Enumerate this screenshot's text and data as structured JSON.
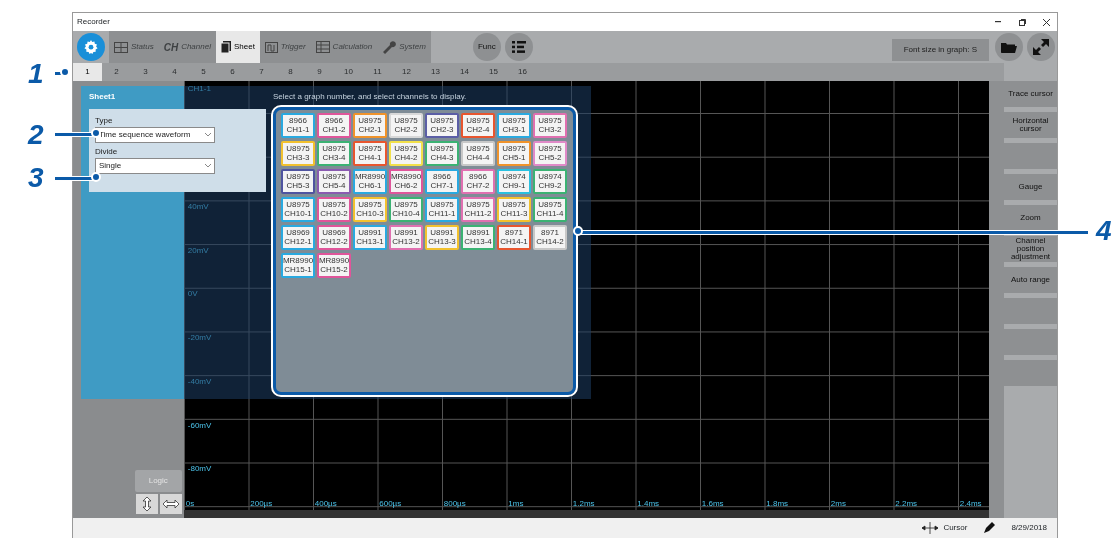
{
  "window": {
    "title": "Recorder"
  },
  "toolbar": {
    "tabs": [
      {
        "kind": "status",
        "label": "Status",
        "selected": false,
        "disabled": true
      },
      {
        "kind": "channel",
        "label": "Channel",
        "icon_text": "CH",
        "selected": false,
        "disabled": true
      },
      {
        "kind": "sheet",
        "label": "Sheet",
        "selected": true,
        "disabled": false
      },
      {
        "kind": "trigger",
        "label": "Trigger",
        "selected": false,
        "disabled": true
      },
      {
        "kind": "calculation",
        "label": "Calculation",
        "selected": false,
        "disabled": true
      },
      {
        "kind": "system",
        "label": "System",
        "selected": false,
        "disabled": true
      }
    ],
    "func_button": "Func",
    "font_size_button": "Font size in graph: S"
  },
  "sheet_tabs": [
    {
      "label": "1",
      "selected": true
    },
    {
      "label": "2",
      "selected": false
    },
    {
      "label": "3",
      "selected": false
    },
    {
      "label": "4",
      "selected": false
    },
    {
      "label": "5",
      "selected": false
    },
    {
      "label": "6",
      "selected": false
    },
    {
      "label": "7",
      "selected": false
    },
    {
      "label": "8",
      "selected": false
    },
    {
      "label": "9",
      "selected": false
    },
    {
      "label": "10",
      "selected": false
    },
    {
      "label": "11",
      "selected": false
    },
    {
      "label": "12",
      "selected": false
    },
    {
      "label": "13",
      "selected": false
    },
    {
      "label": "14",
      "selected": false
    },
    {
      "label": "15",
      "selected": false
    },
    {
      "label": "16",
      "selected": false
    }
  ],
  "sheet_panel": {
    "title": "Sheet1",
    "fields": [
      {
        "label": "Type",
        "value": "Time sequence waveform"
      },
      {
        "label": "Divide",
        "value": "Single"
      }
    ],
    "instruction": "Select a graph number, and select channels to display.",
    "channels": [
      {
        "model": "8966",
        "channel": "CH1-1",
        "color": "#29a9e0"
      },
      {
        "model": "8966",
        "channel": "CH1-2",
        "color": "#e0559a"
      },
      {
        "model": "U8975",
        "channel": "CH2-1",
        "color": "#f0932b"
      },
      {
        "model": "U8975",
        "channel": "CH2-2",
        "color": "#d8d8d8"
      },
      {
        "model": "U8975",
        "channel": "CH2-3",
        "color": "#5b5ea6"
      },
      {
        "model": "U8975",
        "channel": "CH2-4",
        "color": "#e8552e"
      },
      {
        "model": "U8975",
        "channel": "CH3-1",
        "color": "#29a9e0"
      },
      {
        "model": "U8975",
        "channel": "CH3-2",
        "color": "#e070b0"
      },
      {
        "model": "U8975",
        "channel": "CH3-3",
        "color": "#f2c12e"
      },
      {
        "model": "U8975",
        "channel": "CH3-4",
        "color": "#3bb273"
      },
      {
        "model": "U8975",
        "channel": "CH4-1",
        "color": "#e8552e"
      },
      {
        "model": "U8975",
        "channel": "CH4-2",
        "color": "#f2e04a"
      },
      {
        "model": "U8975",
        "channel": "CH4-3",
        "color": "#3bb273"
      },
      {
        "model": "U8975",
        "channel": "CH4-4",
        "color": "#c8c8c8"
      },
      {
        "model": "U8975",
        "channel": "CH5-1",
        "color": "#f0932b"
      },
      {
        "model": "U8975",
        "channel": "CH5-2",
        "color": "#e08ac8"
      },
      {
        "model": "U8975",
        "channel": "CH5-3",
        "color": "#4f54a0"
      },
      {
        "model": "U8975",
        "channel": "CH5-4",
        "color": "#8a5bb0"
      },
      {
        "model": "MR8990",
        "channel": "CH6-1",
        "color": "#29a9e0"
      },
      {
        "model": "MR8990",
        "channel": "CH6-2",
        "color": "#e0559a"
      },
      {
        "model": "8966",
        "channel": "CH7-1",
        "color": "#29a9e0"
      },
      {
        "model": "8966",
        "channel": "CH7-2",
        "color": "#e070b0"
      },
      {
        "model": "U8974",
        "channel": "CH9-1",
        "color": "#29c0e0"
      },
      {
        "model": "U8974",
        "channel": "CH9-2",
        "color": "#3bb273"
      },
      {
        "model": "U8975",
        "channel": "CH10-1",
        "color": "#29a9e0"
      },
      {
        "model": "U8975",
        "channel": "CH10-2",
        "color": "#e0559a"
      },
      {
        "model": "U8975",
        "channel": "CH10-3",
        "color": "#f2c12e"
      },
      {
        "model": "U8975",
        "channel": "CH10-4",
        "color": "#3bb273"
      },
      {
        "model": "U8975",
        "channel": "CH11-1",
        "color": "#29a9e0"
      },
      {
        "model": "U8975",
        "channel": "CH11-2",
        "color": "#e070b0"
      },
      {
        "model": "U8975",
        "channel": "CH11-3",
        "color": "#f2c12e"
      },
      {
        "model": "U8975",
        "channel": "CH11-4",
        "color": "#3bb273"
      },
      {
        "model": "U8969",
        "channel": "CH12-1",
        "color": "#29a9e0"
      },
      {
        "model": "U8969",
        "channel": "CH12-2",
        "color": "#e0559a"
      },
      {
        "model": "U8991",
        "channel": "CH13-1",
        "color": "#29a9e0"
      },
      {
        "model": "U8991",
        "channel": "CH13-2",
        "color": "#e070b0"
      },
      {
        "model": "U8991",
        "channel": "CH13-3",
        "color": "#f2c12e"
      },
      {
        "model": "U8991",
        "channel": "CH13-4",
        "color": "#3bb273"
      },
      {
        "model": "8971",
        "channel": "CH14-1",
        "color": "#e8552e"
      },
      {
        "model": "8971",
        "channel": "CH14-2",
        "color": "#c8c8c8"
      },
      {
        "model": "MR8990",
        "channel": "CH15-1",
        "color": "#29a9e0"
      },
      {
        "model": "MR8990",
        "channel": "CH15-2",
        "color": "#e0559a"
      }
    ]
  },
  "graph": {
    "channel_label": "CH1-1",
    "y_labels": [
      "40mV",
      "20mV",
      "0V",
      "-20mV",
      "-40mV",
      "-60mV",
      "-80mV"
    ],
    "x_labels": [
      "0s",
      "200µs",
      "400µs",
      "600µs",
      "800µs",
      "1ms",
      "1.2ms",
      "1.4ms",
      "1.6ms",
      "1.8ms",
      "2ms",
      "2.2ms",
      "2.4ms"
    ]
  },
  "logic_button": {
    "label": "Logic",
    "disabled": true
  },
  "side_buttons": [
    {
      "kind": "label",
      "label": "Trace cursor"
    },
    {
      "kind": "label",
      "label": "Horizontal cursor"
    },
    {
      "kind": "blank"
    },
    {
      "kind": "label",
      "label": "Gauge"
    },
    {
      "kind": "label",
      "label": "Zoom"
    },
    {
      "kind": "label",
      "label": "Channel position adjustment"
    },
    {
      "kind": "label",
      "label": "Auto range"
    },
    {
      "kind": "blank"
    },
    {
      "kind": "blank"
    },
    {
      "kind": "blank"
    }
  ],
  "status_bar": {
    "cursor_label": "Cursor",
    "date": "8/29/2018"
  },
  "callouts": [
    "1",
    "2",
    "3",
    "4"
  ]
}
